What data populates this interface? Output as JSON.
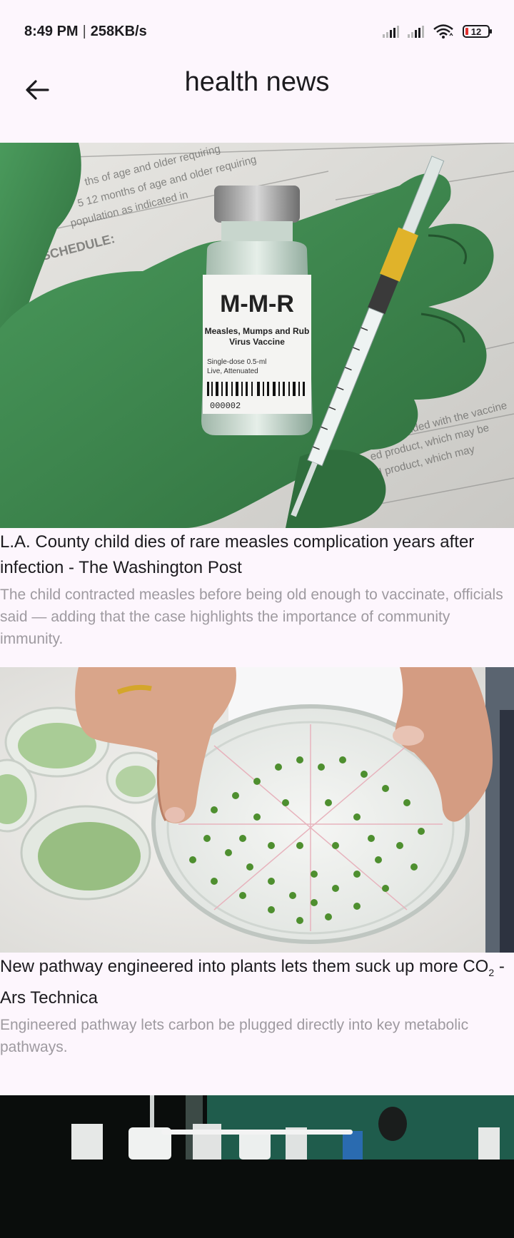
{
  "status_bar": {
    "time": "8:49 PM",
    "separator": "|",
    "net_speed": "258KB/s",
    "battery_level": "12"
  },
  "header": {
    "title": "health news",
    "back_icon": "arrow-left-icon"
  },
  "articles": [
    {
      "title": "L.A. County child dies of rare measles complication years after infection - The Washington Post",
      "description": "The child contracted measles before being old enough to vaccinate, officials said — adding that the case highlights the importance of community immunity.",
      "image": {
        "vial_brand": "M-M-R",
        "vial_line1": "Measles, Mumps and Rub",
        "vial_line2": "Virus Vaccine",
        "vial_small1": "Single-dose 0.5-ml",
        "vial_small2": "Live, Attenuated",
        "vial_code": "000002",
        "doc_heading": "SCHEDULE:"
      }
    },
    {
      "title_pre": "New pathway engineered into plants lets them suck up more CO",
      "title_sub": "2",
      "title_post": " - Ars Technica",
      "description": "Engineered pathway lets carbon be plugged directly into key metabolic pathways."
    },
    {
      "title": "",
      "description": ""
    }
  ],
  "colors": {
    "background": "#fdf6fd",
    "glove_green": "#3d8a4f",
    "description_gray": "#9e9aa0"
  }
}
